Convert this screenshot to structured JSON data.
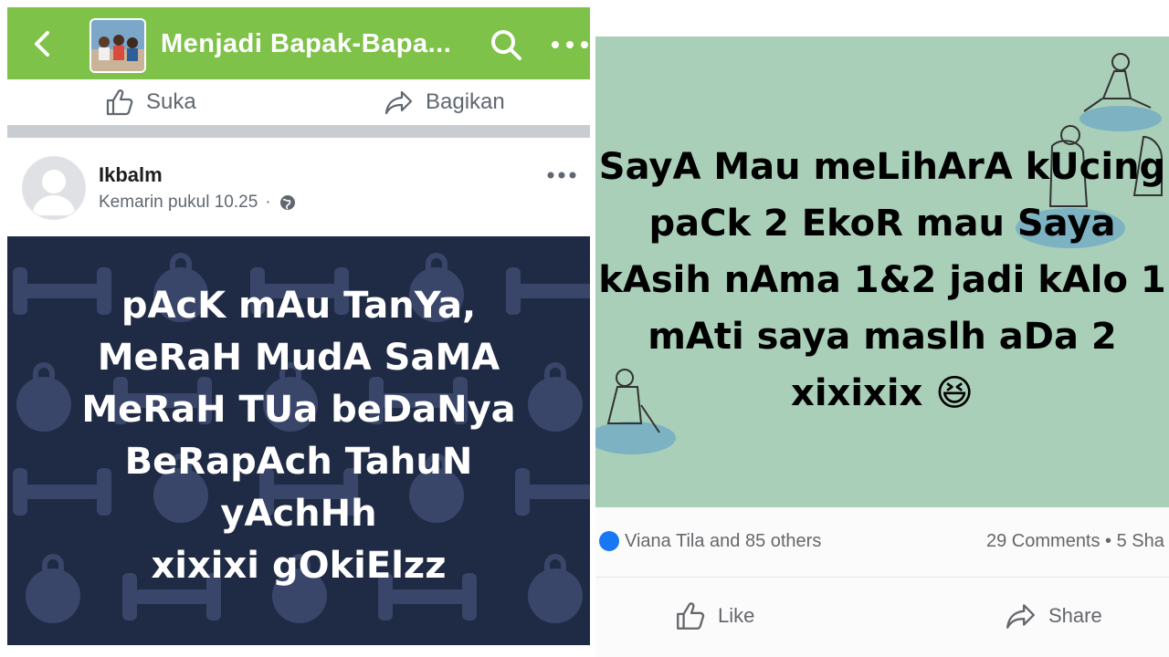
{
  "left": {
    "group_title": "Menjadi Bapak-Bapa...",
    "actions": {
      "like": "Suka",
      "share": "Bagikan"
    },
    "post": {
      "author": "Ikbalm",
      "time": "Kemarin pukul 10.25",
      "separator": "·",
      "lines": [
        "pAcK mAu TanYa,",
        "MeRaH MudA SaMA",
        "MeRaH TUa beDaNya",
        "BeRapAch TahuN",
        "yAchHh",
        "xixixi gOkiElzz"
      ]
    }
  },
  "right": {
    "post_lines": [
      "SayA Mau meLihArA kUcing",
      "paCk 2 EkoR mau Saya",
      "kAsih nAma 1&2 jadi kAlo 1",
      "mAti saya maslh aDa 2",
      "xixixix 😆"
    ],
    "reactions": {
      "names": "Viana Tila and 85 others",
      "counts": "29 Comments • 5 Sha"
    },
    "actions": {
      "like": "Like",
      "share": "Share"
    }
  },
  "colors": {
    "group_green": "#7ec24a",
    "card_navy": "#1f2a44",
    "card_mint": "#a9cfb8"
  }
}
